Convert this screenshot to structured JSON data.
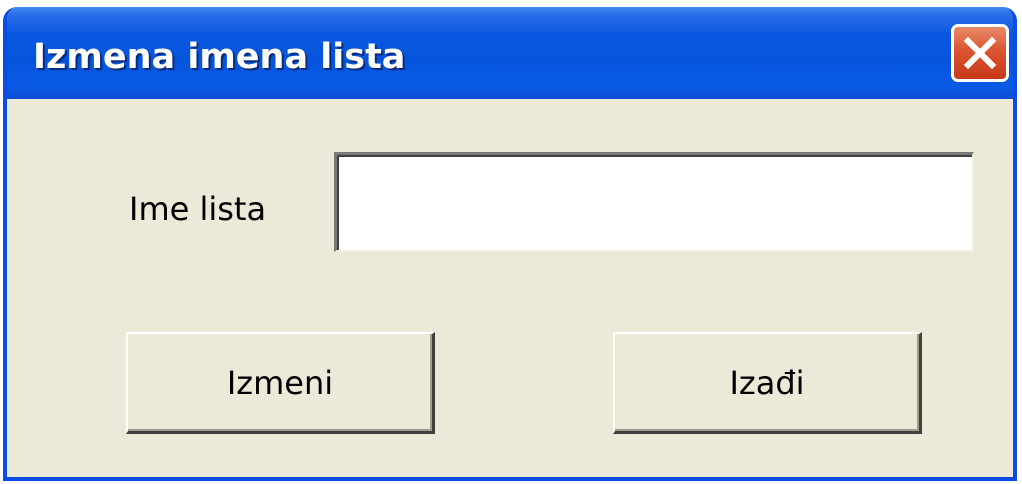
{
  "window": {
    "title": "Izmena imena lista",
    "close_icon": "close-icon"
  },
  "form": {
    "label": "Ime lista",
    "value": ""
  },
  "buttons": {
    "rename_label": "Izmeni",
    "exit_label": "Izađi"
  },
  "colors": {
    "titlebar": "#0654dc",
    "dialog_bg": "#ece9d8",
    "close_button": "#db5532"
  }
}
